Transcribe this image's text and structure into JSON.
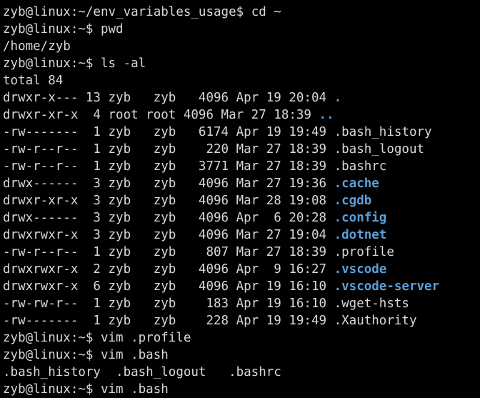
{
  "terminal": {
    "colors": {
      "background": "#000000",
      "foreground": "#d8d8d8",
      "directory": "#5c9fd8"
    },
    "prompt_home": "zyb@linux:~$ ",
    "prompt_project": "zyb@linux:~/env_variables_usage$ ",
    "lines": [
      {
        "name": "prompt-line-cd",
        "prompt": "zyb@linux:~/env_variables_usage$ ",
        "command": "cd ~"
      },
      {
        "name": "prompt-line-pwd",
        "prompt": "zyb@linux:~$ ",
        "command": "pwd"
      },
      {
        "name": "output-line-pwd",
        "text": "/home/zyb"
      },
      {
        "name": "prompt-line-ls",
        "prompt": "zyb@linux:~$ ",
        "command": "ls -al"
      },
      {
        "name": "output-line-total",
        "text": "total 84"
      },
      {
        "name": "listing-row-dot",
        "text": "drwxr-x--- 13 zyb   zyb   4096 Apr 19 20:04 ",
        "entry": ".",
        "entry_type": "dir"
      },
      {
        "name": "listing-row-dotdot",
        "text": "drwxr-xr-x  4 root root 4096 Mar 27 18:39 ",
        "entry": "..",
        "entry_type": "dir"
      },
      {
        "name": "listing-row-bash-history",
        "text": "-rw-------  1 zyb   zyb   6174 Apr 19 19:49 ",
        "entry": ".bash_history",
        "entry_type": "file"
      },
      {
        "name": "listing-row-bash-logout",
        "text": "-rw-r--r--  1 zyb   zyb    220 Mar 27 18:39 ",
        "entry": ".bash_logout",
        "entry_type": "file"
      },
      {
        "name": "listing-row-bashrc",
        "text": "-rw-r--r--  1 zyb   zyb   3771 Mar 27 18:39 ",
        "entry": ".bashrc",
        "entry_type": "file"
      },
      {
        "name": "listing-row-cache",
        "text": "drwx------  3 zyb   zyb   4096 Mar 27 19:36 ",
        "entry": ".cache",
        "entry_type": "dir"
      },
      {
        "name": "listing-row-cgdb",
        "text": "drwxr-xr-x  3 zyb   zyb   4096 Mar 28 19:08 ",
        "entry": ".cgdb",
        "entry_type": "dir"
      },
      {
        "name": "listing-row-config",
        "text": "drwx------  3 zyb   zyb   4096 Apr  6 20:28 ",
        "entry": ".config",
        "entry_type": "dir"
      },
      {
        "name": "listing-row-dotnet",
        "text": "drwxrwxr-x  3 zyb   zyb   4096 Mar 27 19:04 ",
        "entry": ".dotnet",
        "entry_type": "dir"
      },
      {
        "name": "listing-row-profile",
        "text": "-rw-r--r--  1 zyb   zyb    807 Mar 27 18:39 ",
        "entry": ".profile",
        "entry_type": "file"
      },
      {
        "name": "listing-row-vscode",
        "text": "drwxrwxr-x  2 zyb   zyb   4096 Apr  9 16:27 ",
        "entry": ".vscode",
        "entry_type": "dir"
      },
      {
        "name": "listing-row-vscode-server",
        "text": "drwxrwxr-x  6 zyb   zyb   4096 Apr 19 16:10 ",
        "entry": ".vscode-server",
        "entry_type": "dir"
      },
      {
        "name": "listing-row-wget-hsts",
        "text": "-rw-rw-r--  1 zyb   zyb    183 Apr 19 16:10 ",
        "entry": ".wget-hsts",
        "entry_type": "file"
      },
      {
        "name": "listing-row-xauthority",
        "text": "-rw-------  1 zyb   zyb    228 Apr 19 19:49 ",
        "entry": ".Xauthority",
        "entry_type": "file"
      },
      {
        "name": "prompt-line-vim-profile",
        "prompt": "zyb@linux:~$ ",
        "command": "vim .profile"
      },
      {
        "name": "prompt-line-vim-bash-1",
        "prompt": "zyb@linux:~$ ",
        "command": "vim .bash"
      },
      {
        "name": "completion-line",
        "text": ".bash_history  .bash_logout   .bashrc"
      },
      {
        "name": "prompt-line-vim-bash-2",
        "prompt": "zyb@linux:~$ ",
        "command": "vim .bash"
      }
    ],
    "completion_candidates": [
      ".bash_history",
      ".bash_logout",
      ".bashrc"
    ],
    "listing_total": "total 84",
    "working_directory": "/home/zyb"
  }
}
